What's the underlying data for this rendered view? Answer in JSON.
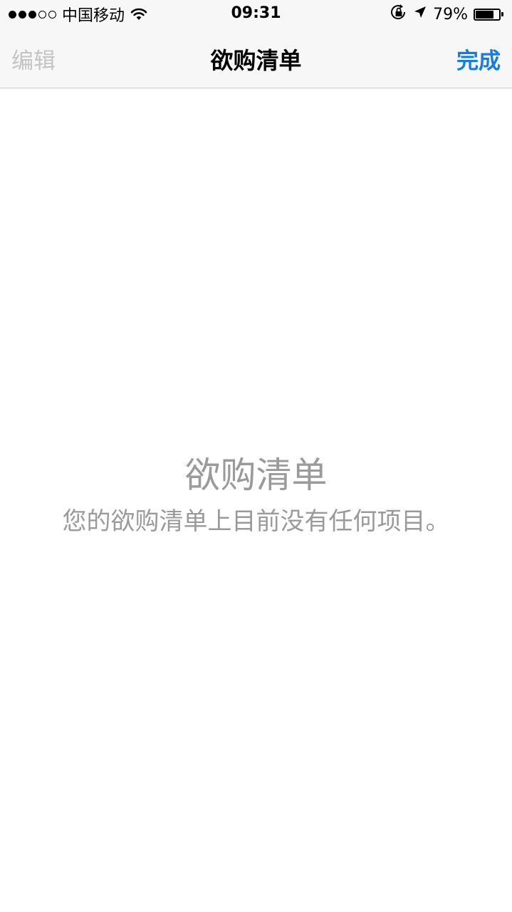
{
  "status_bar": {
    "signal_filled": 3,
    "signal_total": 5,
    "carrier": "中国移动",
    "time": "09:31",
    "battery_percent_label": "79%",
    "battery_level": 0.79,
    "icons": [
      "signal-dots-icon",
      "wifi-icon",
      "orientation-lock-icon",
      "location-arrow-icon",
      "battery-icon"
    ]
  },
  "nav": {
    "edit_label": "编辑",
    "title": "欲购清单",
    "done_label": "完成",
    "colors": {
      "edit_disabled": "#c4c4c4",
      "done_accent": "#147ee0"
    }
  },
  "empty_state": {
    "title": "欲购清单",
    "message": "您的欲购清单上目前没有任何项目。",
    "color": "#9a9a9a"
  }
}
